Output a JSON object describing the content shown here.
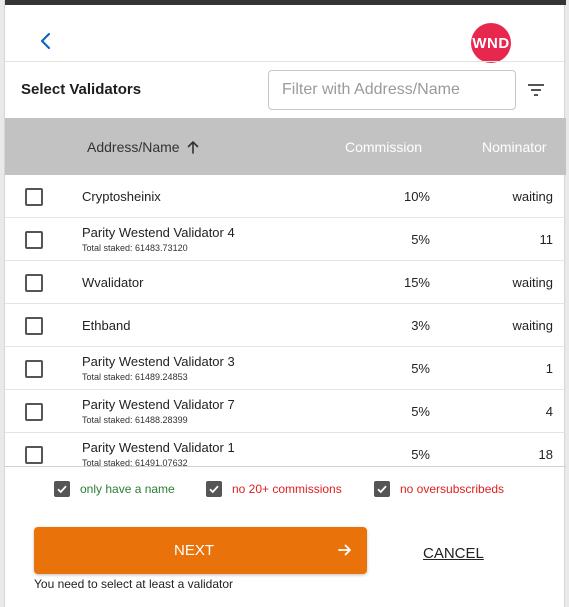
{
  "header": {
    "logo_text": "WND",
    "logo_color": "#e8274f"
  },
  "title": "Select Validators",
  "filter": {
    "placeholder": "Filter with Address/Name",
    "value": ""
  },
  "table": {
    "columns": {
      "address": "Address/Name",
      "commission": "Commission",
      "nominator": "Nominator"
    },
    "sort": "ascending",
    "rows": [
      {
        "name": "Cryptosheinix",
        "staked": "",
        "commission": "10%",
        "nominator": "waiting"
      },
      {
        "name": "Parity Westend Validator 4",
        "staked": "Total staked: 61483.73120",
        "commission": "5%",
        "nominator": "11"
      },
      {
        "name": "Wvalidator",
        "staked": "",
        "commission": "15%",
        "nominator": "waiting"
      },
      {
        "name": "Ethband",
        "staked": "",
        "commission": "3%",
        "nominator": "waiting"
      },
      {
        "name": "Parity Westend Validator 3",
        "staked": "Total staked: 61489.24853",
        "commission": "5%",
        "nominator": "1"
      },
      {
        "name": "Parity Westend Validator 7",
        "staked": "Total staked: 61488.28399",
        "commission": "5%",
        "nominator": "4"
      },
      {
        "name": "Parity Westend Validator 1",
        "staked": "Total staked: 61491.07632",
        "commission": "5%",
        "nominator": "18"
      }
    ]
  },
  "options": [
    {
      "label": "only have a name",
      "color": "#2e7d32",
      "checked": true
    },
    {
      "label": "no 20+ commissions",
      "color": "#e02020",
      "checked": true
    },
    {
      "label": "no oversubscribeds",
      "color": "#e02020",
      "checked": true
    }
  ],
  "actions": {
    "next_label": "NEXT",
    "cancel_label": "CANCEL",
    "next_color": "#e9730a"
  },
  "hint": "You need to select at least a validator"
}
